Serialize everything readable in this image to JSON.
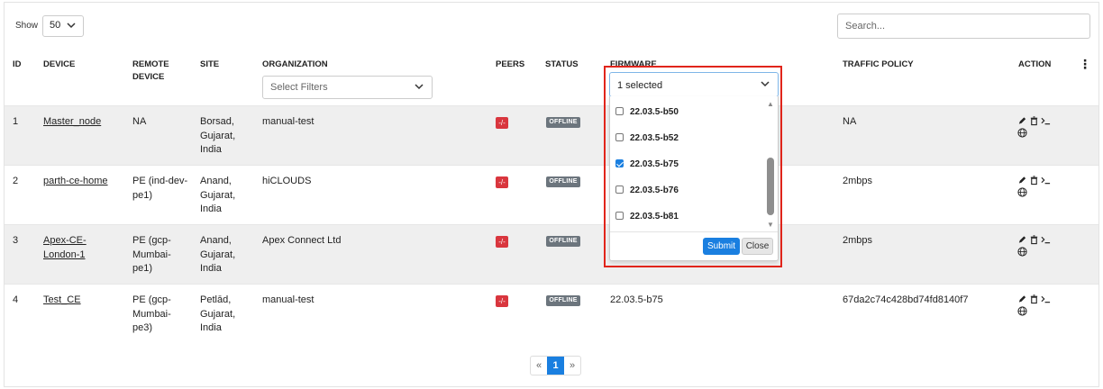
{
  "toolbar": {
    "show_label": "Show",
    "page_size": "50",
    "search_placeholder": "Search..."
  },
  "headers": {
    "id": "ID",
    "device": "DEVICE",
    "remote_device": "REMOTE DEVICE",
    "site": "SITE",
    "organization": "ORGANIZATION",
    "peers": "PEERS",
    "status": "STATUS",
    "firmware": "FIRMWARE",
    "traffic_policy": "TRAFFIC POLICY",
    "action": "ACTION",
    "menu": "⋮"
  },
  "org_filter": {
    "placeholder": "Select Filters"
  },
  "firmware_filter": {
    "value": "1 selected",
    "options": [
      {
        "label": "22.03.5-b50",
        "checked": false
      },
      {
        "label": "22.03.5-b52",
        "checked": false
      },
      {
        "label": "22.03.5-b75",
        "checked": true
      },
      {
        "label": "22.03.5-b76",
        "checked": false
      },
      {
        "label": "22.03.5-b81",
        "checked": false
      }
    ],
    "submit_label": "Submit",
    "close_label": "Close"
  },
  "rows": [
    {
      "id": "1",
      "device": "Master_node",
      "remote_device": [
        "NA"
      ],
      "site": [
        "Borsad,",
        "Gujarat,",
        "India"
      ],
      "organization": "manual-test",
      "peers": "-/-",
      "status": "OFFLINE",
      "firmware": "",
      "traffic_policy": "NA"
    },
    {
      "id": "2",
      "device": "parth-ce-home",
      "remote_device": [
        "PE (ind-dev-",
        "pe1)"
      ],
      "site": [
        "Anand,",
        "Gujarat,",
        "India"
      ],
      "organization": "hiCLOUDS",
      "peers": "-/-",
      "status": "OFFLINE",
      "firmware": "",
      "traffic_policy": "2mbps"
    },
    {
      "id": "3",
      "device": "Apex-CE-London-1",
      "remote_device": [
        "PE (gcp-",
        "Mumbai-",
        "pe1)"
      ],
      "site": [
        "Anand,",
        "Gujarat,",
        "India"
      ],
      "organization": "Apex Connect Ltd",
      "peers": "-/-",
      "status": "OFFLINE",
      "firmware": "",
      "traffic_policy": "2mbps"
    },
    {
      "id": "4",
      "device": "Test_CE",
      "remote_device": [
        "PE (gcp-",
        "Mumbai-",
        "pe3)"
      ],
      "site": [
        "Petlād,",
        "Gujarat,",
        "India"
      ],
      "organization": "manual-test",
      "peers": "-/-",
      "status": "OFFLINE",
      "firmware": "22.03.5-b75",
      "traffic_policy": "67da2c74c428bd74fd8140f7"
    }
  ],
  "pagination": {
    "prev": "«",
    "current": "1",
    "next": "»"
  },
  "colors": {
    "accent": "#1a7fe0",
    "peer_badge": "#d9363e",
    "status_badge": "#6c757d",
    "highlight": "#e1251b"
  }
}
